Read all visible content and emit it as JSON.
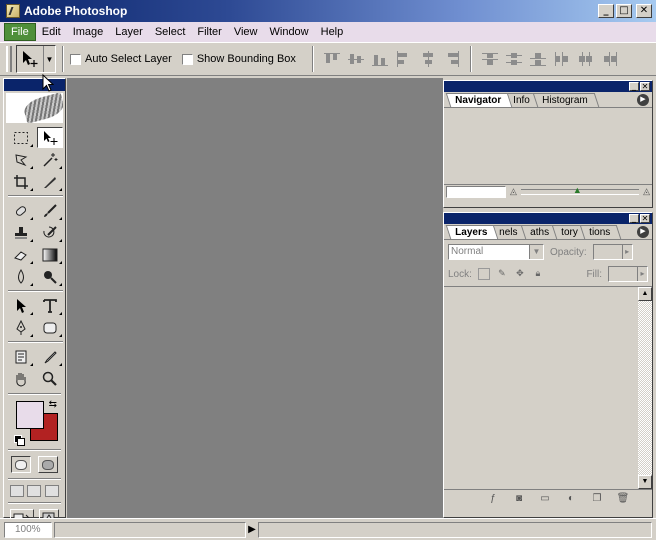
{
  "window": {
    "title": "Adobe Photoshop",
    "minimize": "_",
    "maximize": "□",
    "close": "✕"
  },
  "menu": [
    "File",
    "Edit",
    "Image",
    "Layer",
    "Select",
    "Filter",
    "View",
    "Window",
    "Help"
  ],
  "options": {
    "auto_select_label": "Auto Select Layer",
    "bounding_box_label": "Show Bounding Box",
    "auto_select_checked": false,
    "bounding_box_checked": false
  },
  "colors": {
    "foreground": "#e8dcea",
    "background": "#b22222",
    "menu_active": "#4f8f3a"
  },
  "navigator_palette": {
    "tabs": [
      "Navigator",
      "Info",
      "Histogram"
    ],
    "active_tab": "Navigator"
  },
  "layers_palette": {
    "tabs": [
      "Layers",
      "nels",
      "aths",
      "tory",
      "tions"
    ],
    "active_tab": "Layers",
    "blend_mode": "Normal",
    "opacity_label": "Opacity:",
    "lock_label": "Lock:",
    "fill_label": "Fill:"
  },
  "status": {
    "zoom": "100%"
  }
}
